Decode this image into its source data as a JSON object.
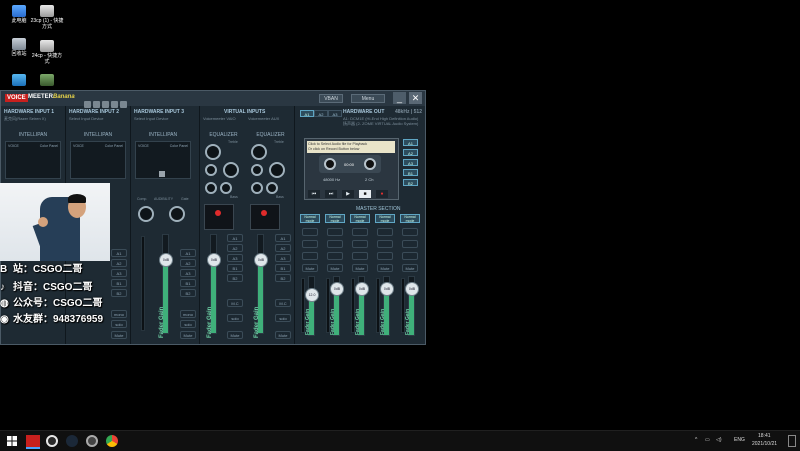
{
  "desktop": {
    "icons": [
      {
        "label": "此电脑",
        "icon": "computer-icon"
      },
      {
        "label": "23cp (1) - 快捷方式",
        "icon": "shortcut-icon"
      },
      {
        "label": "回收站",
        "icon": "recycle-bin-icon"
      },
      {
        "label": "24cp - 快捷方式",
        "icon": "shortcut-icon"
      }
    ]
  },
  "voicemeeter": {
    "logo": {
      "voice": "VOICE",
      "meeter": "MEETER",
      "banana": "Banana"
    },
    "vban_label": "VBAN",
    "menu_label": "Menu",
    "minimize": "_",
    "close": "✕",
    "strips": [
      {
        "title": "HARDWARE INPUT 1",
        "device": "麦克风(Razer Seiren X)",
        "intelli": "INTELLIPAN",
        "panel_voice": "VOICE",
        "panel_color": "Color Panel",
        "fader_label": "Fader Gain"
      },
      {
        "title": "HARDWARE INPUT 2",
        "device": "Select Input Device",
        "intelli": "INTELLIPAN",
        "panel_voice": "VOICE",
        "panel_color": "Color Panel",
        "fader_label": "Fader Gain"
      },
      {
        "title": "HARDWARE INPUT 3",
        "device": "Select Input Device",
        "intelli": "INTELLIPAN",
        "panel_voice": "VOICE",
        "panel_color": "Color Panel",
        "fader_label": "Fader Gain",
        "comp": "Comp.",
        "audibility": "AUDIBILITY",
        "gate": "Gate"
      }
    ],
    "virtual": {
      "title": "VIRTUAL INPUTS",
      "vaio": "Voicemeeter VAIO",
      "aux": "Voicemeeter AUX",
      "equalizer": "EQUALIZER",
      "treble": "Treble",
      "bass": "Bass",
      "fader_label": "Fader Gain"
    },
    "bus_buttons": [
      "A1",
      "A2",
      "A3",
      "B1",
      "B2"
    ],
    "strip_controls": {
      "mono": "mono",
      "solo": "solo",
      "mute": "Mute",
      "mc": "M.C"
    },
    "fader_values": {
      "db": "0dB",
      "master1": "12.0"
    },
    "hardware_out": {
      "title": "HARDWARE OUT",
      "rate": "48kHz | 512",
      "a_buttons": [
        "A1",
        "A2",
        "A3"
      ],
      "out1": "A1: DCM1E (Hi-End High Definition Audio)",
      "out2": "扬声器 (2- ZOME VIRTUAL Audio System)"
    },
    "cassette": {
      "message1": "Click to Select Audio file for Playback",
      "message2": "Or click on Record Button below",
      "time": "00:00",
      "hz": "48000 Hz",
      "ch": "2 Ch",
      "transport": [
        "⏮",
        "⏭",
        "▶",
        "■",
        "●"
      ]
    },
    "master_section": {
      "title": "MASTER SECTION",
      "normal_mode": "Normal mode",
      "labels": [
        "A1",
        "A2",
        "A3",
        "B1",
        "B2"
      ],
      "fader_label": "Fader Gain"
    }
  },
  "overlay": {
    "lines": [
      {
        "pre": "B",
        "text": "站：CSGO二哥"
      },
      {
        "pre": "♪",
        "text": "抖音：CSGO二哥"
      },
      {
        "pre": "◍",
        "text": "公众号：CSGO二哥"
      },
      {
        "pre": "◉",
        "text": "水友群：948376959"
      }
    ]
  },
  "taskbar": {
    "lang": "ENG",
    "time": "18:41",
    "date": "2021/10/21"
  }
}
